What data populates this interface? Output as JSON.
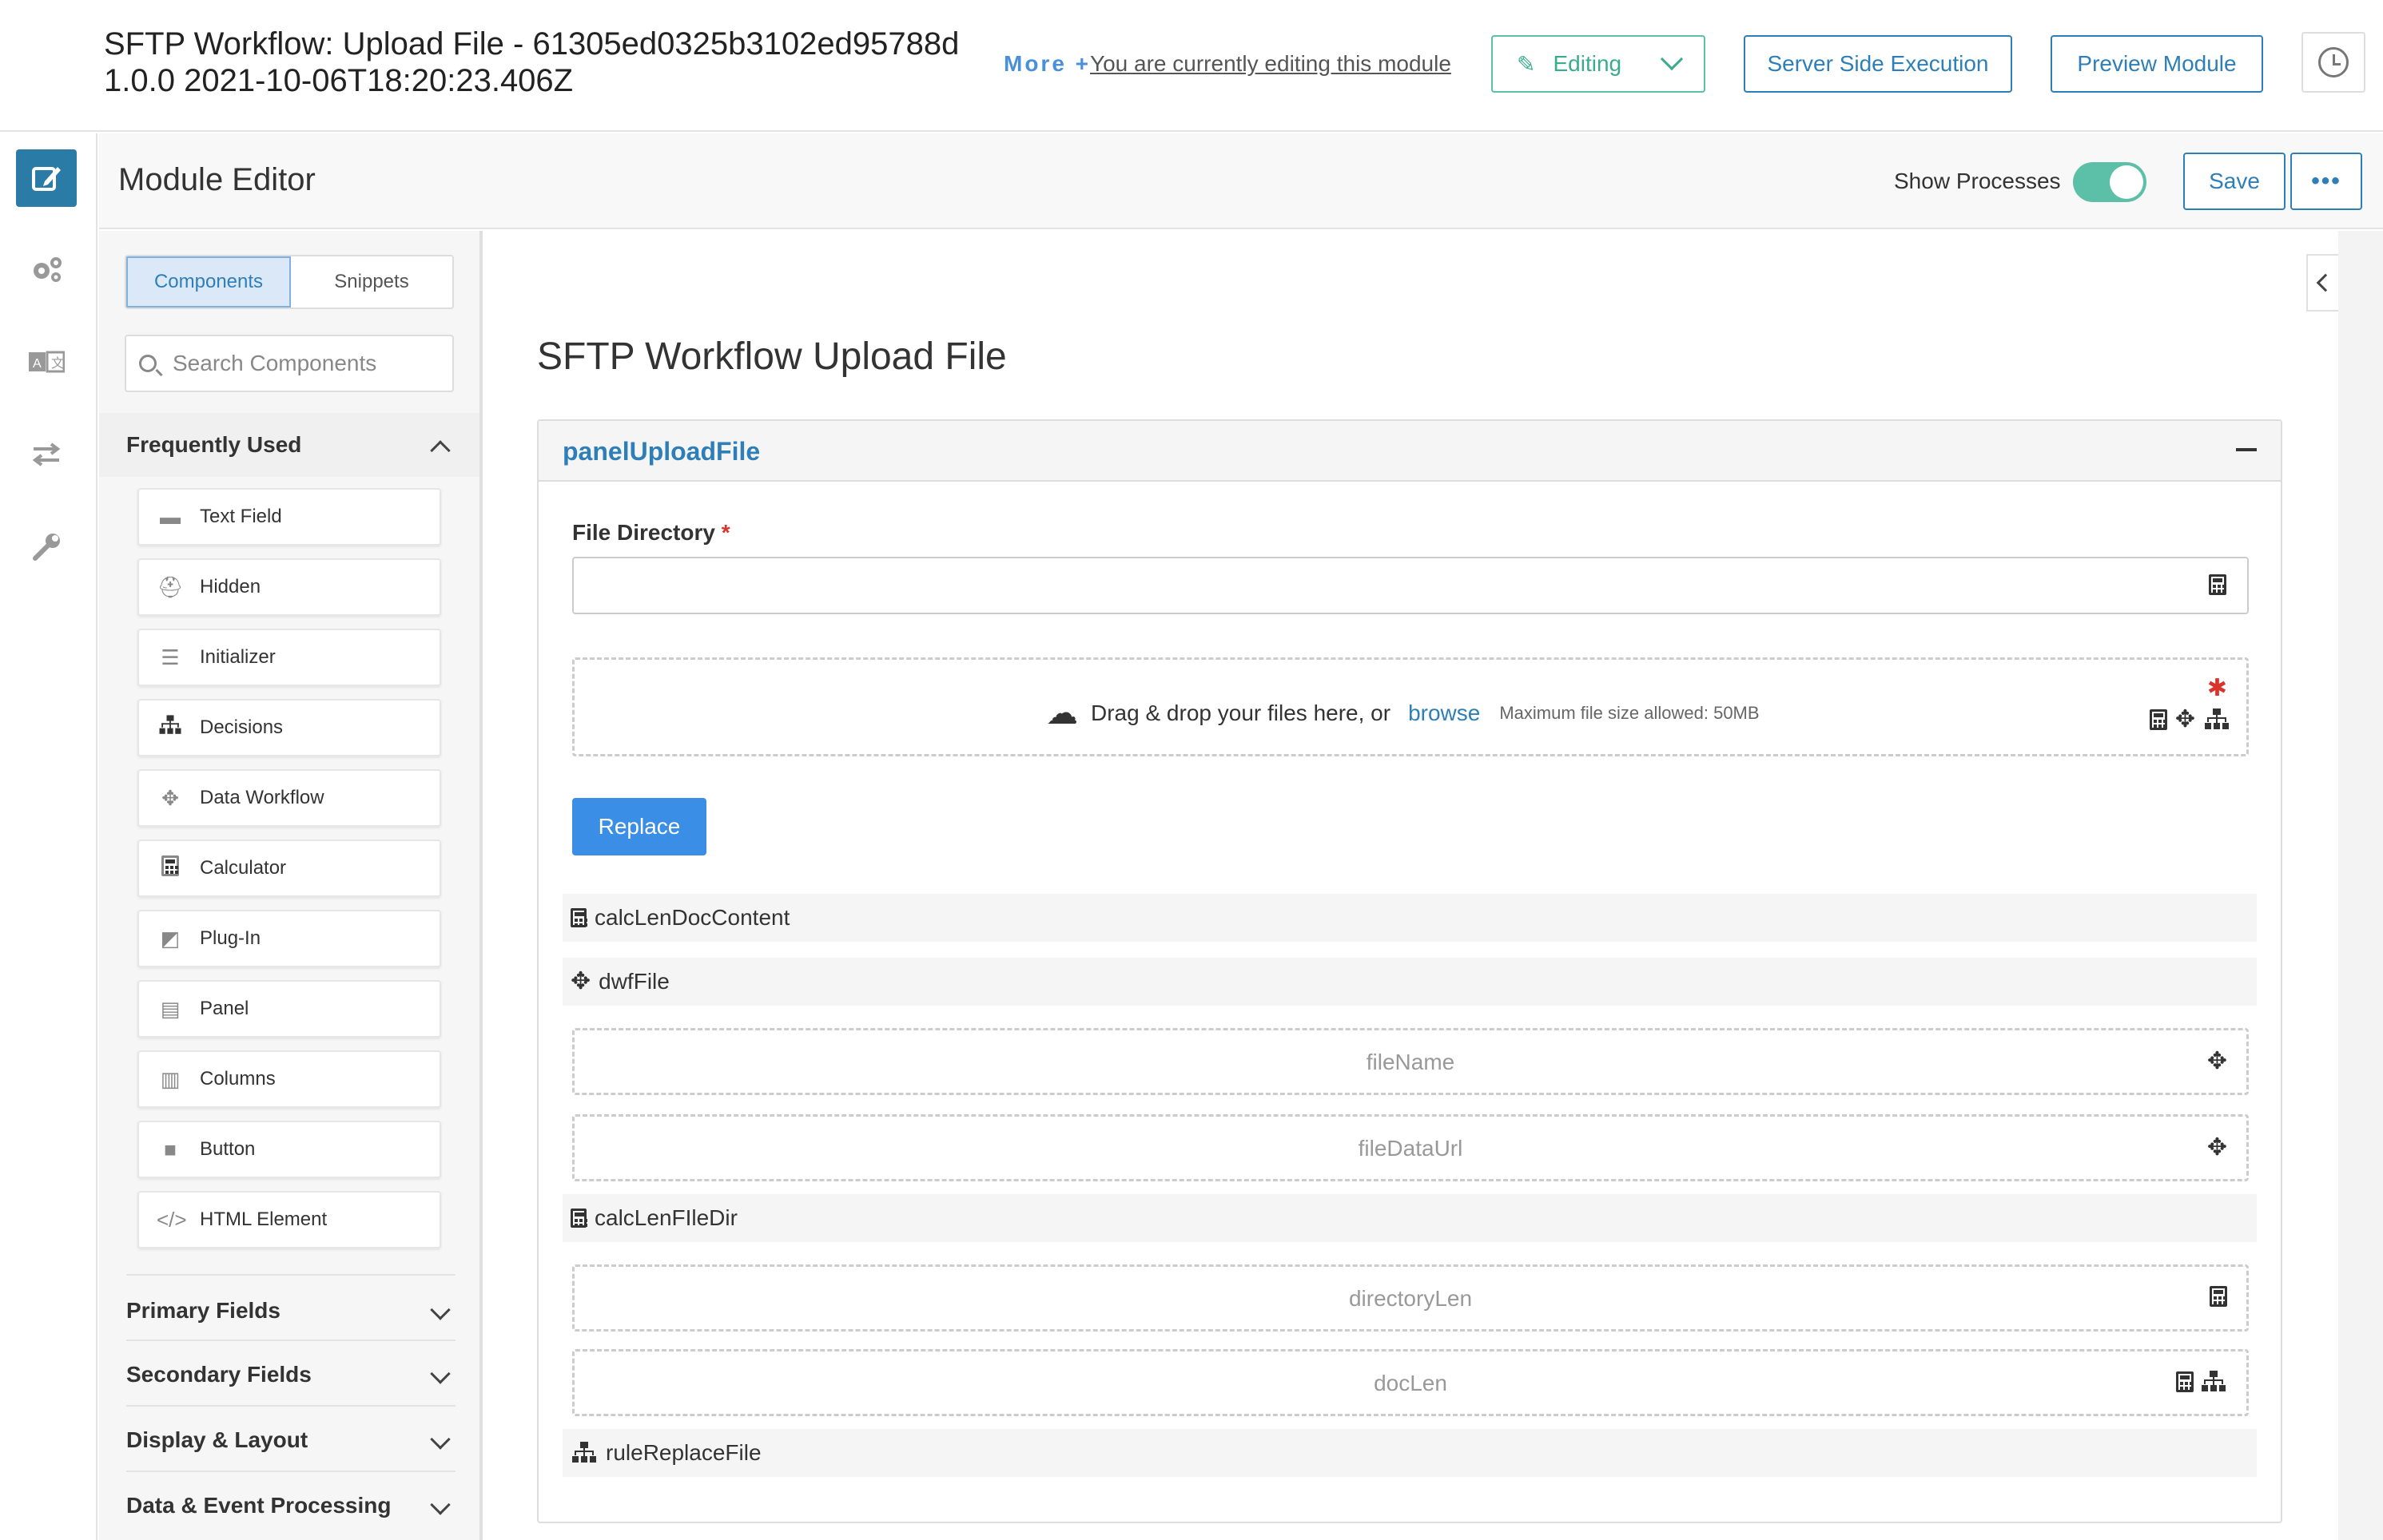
{
  "header": {
    "title_line1": "SFTP Workflow: Upload File - 61305ed0325b3102ed95788d",
    "title_line2": "1.0.0 2021-10-06T18:20:23.406Z",
    "more_label": "More +",
    "editing_message": "You are currently editing this module",
    "editing_button": "Editing",
    "server_side_button": "Server Side Execution",
    "preview_button": "Preview Module"
  },
  "editor": {
    "title": "Module Editor",
    "show_processes_label": "Show Processes",
    "show_processes_on": true,
    "save_button": "Save",
    "more_button": "•••"
  },
  "sidebar": {
    "tabs": [
      "Components",
      "Snippets"
    ],
    "active_tab": "Components",
    "search_placeholder": "Search Components",
    "frequently_used_title": "Frequently Used",
    "items": [
      {
        "label": "Text Field",
        "icon": "minus-icon"
      },
      {
        "label": "Hidden",
        "icon": "user-secret-icon"
      },
      {
        "label": "Initializer",
        "icon": "sliders-icon"
      },
      {
        "label": "Decisions",
        "icon": "sitemap-icon"
      },
      {
        "label": "Data Workflow",
        "icon": "arrows-icon"
      },
      {
        "label": "Calculator",
        "icon": "calculator-icon"
      },
      {
        "label": "Plug-In",
        "icon": "image-icon"
      },
      {
        "label": "Panel",
        "icon": "list-alt-icon"
      },
      {
        "label": "Columns",
        "icon": "columns-icon"
      },
      {
        "label": "Button",
        "icon": "stop-icon"
      },
      {
        "label": "HTML Element",
        "icon": "code-icon"
      }
    ],
    "sections": [
      "Primary Fields",
      "Secondary Fields",
      "Display & Layout",
      "Data & Event Processing"
    ]
  },
  "canvas": {
    "title": "SFTP Workflow Upload File",
    "panel_title": "panelUploadFile",
    "file_directory_label": "File Directory",
    "required_mark": "*",
    "dropzone_text": "Drag & drop your files here, or",
    "dropzone_browse": "browse",
    "dropzone_max": "Maximum file size allowed: 50MB",
    "replace_button": "Replace",
    "rows": {
      "calc_doc": "calcLenDocContent",
      "dwf_file": "dwfFile",
      "file_name": "fileName",
      "file_data_url": "fileDataUrl",
      "calc_dir": "calcLenFIleDir",
      "directory_len": "directoryLen",
      "doc_len": "docLen",
      "rule_replace": "ruleReplaceFile"
    }
  },
  "colors": {
    "primary": "#2e7fb8",
    "accent_green": "#5bc0a7",
    "replace_blue": "#3a8ee6",
    "required_red": "#d9342b"
  }
}
